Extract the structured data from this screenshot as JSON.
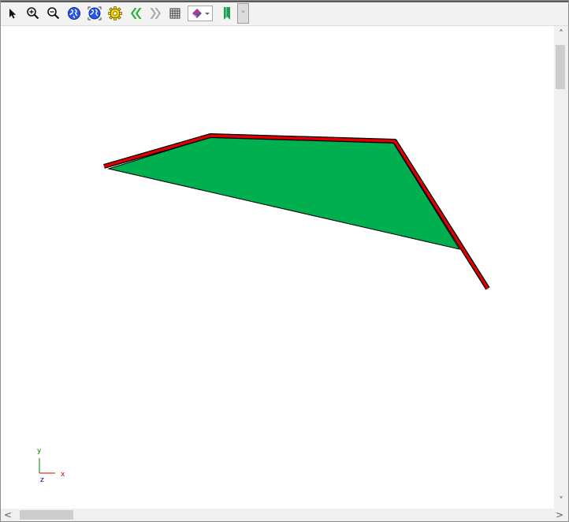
{
  "toolbar": {
    "buttons": [
      {
        "id": "select",
        "icon": "pointer-icon"
      },
      {
        "id": "zoom-in",
        "icon": "zoom-in-icon"
      },
      {
        "id": "zoom-out",
        "icon": "zoom-out-icon"
      },
      {
        "id": "globe",
        "icon": "globe-icon"
      },
      {
        "id": "globe-extent",
        "icon": "globe-extent-icon"
      },
      {
        "id": "settings",
        "icon": "gear-icon"
      },
      {
        "id": "previous",
        "icon": "double-chevron-left-icon"
      },
      {
        "id": "next",
        "icon": "double-chevron-right-icon"
      },
      {
        "id": "grid",
        "icon": "grid-icon"
      },
      {
        "id": "color-style",
        "icon": "color-palette-icon"
      },
      {
        "id": "bookmark",
        "icon": "bookmark-icon"
      }
    ],
    "overflow_label": "»"
  },
  "axis": {
    "x_label": "x",
    "y_label": "y",
    "z_label": "z"
  },
  "scrollbars": {
    "up": "˄",
    "down": "˅",
    "left": "<",
    "right": ">"
  },
  "colors": {
    "polygon_fill": "#00b050",
    "edge_stroke": "#e00000",
    "outline": "#000000",
    "x_axis": "#e00000",
    "y_axis": "#008000",
    "z_axis": "#0000cc"
  }
}
